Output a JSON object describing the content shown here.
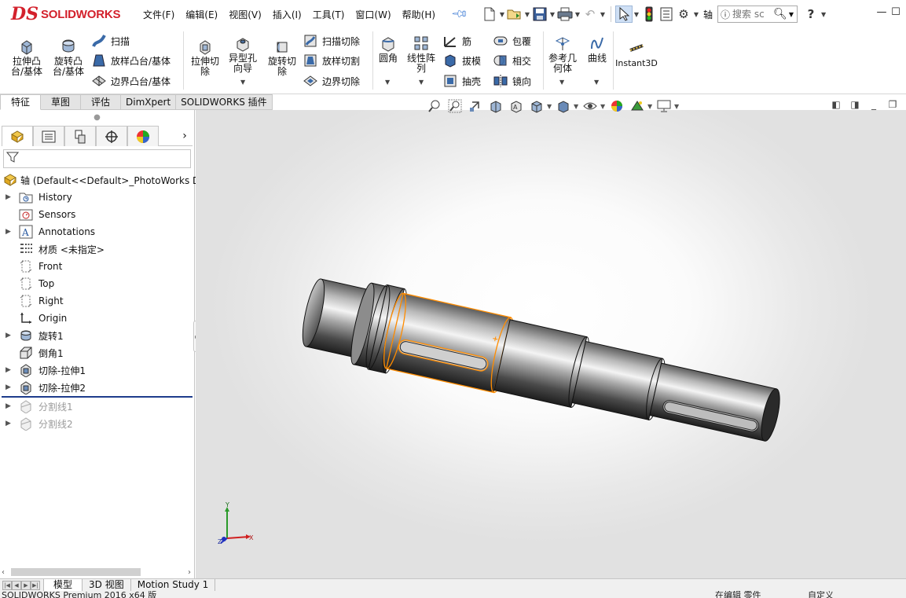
{
  "app": {
    "logo_ds": "DS",
    "logo_text": "SOLIDWORKS",
    "colors": {
      "brand": "#d3212c",
      "selection": "#ff8c00",
      "rollback_bar": "#1e3c8c"
    }
  },
  "menu": [
    "文件(F)",
    "编辑(E)",
    "视图(V)",
    "插入(I)",
    "工具(T)",
    "窗口(W)",
    "帮助(H)"
  ],
  "quick_access": {
    "icons": [
      "new-document-icon",
      "open-icon",
      "save-icon",
      "print-icon",
      "undo-icon",
      "select-pointer-icon",
      "rebuild-icon",
      "file-properties-icon",
      "options-gear-icon"
    ],
    "document_name": "轴",
    "search_placeholder": "搜索 sc",
    "help_label": "?"
  },
  "ribbon": {
    "extrude_boss": "拉伸凸\n台/基体",
    "revolve_boss": "旋转凸\n台/基体",
    "sweep": "扫描",
    "loft_boss": "放样凸台/基体",
    "boundary_boss": "边界凸台/基体",
    "extrude_cut": "拉伸切\n除",
    "hole_wizard": "异型孔\n向导",
    "revolve_cut": "旋转切\n除",
    "swept_cut": "扫描切除",
    "lofted_cut": "放样切割",
    "boundary_cut": "边界切除",
    "fillet": "圆角",
    "linear_pattern": "线性阵\n列",
    "rib": "筋",
    "draft": "拔模",
    "shell": "抽壳",
    "wrap": "包覆",
    "intersect": "相交",
    "mirror": "镜向",
    "ref_geometry": "参考几\n何体",
    "curves": "曲线",
    "instant3d": "Instant3D"
  },
  "cm_tabs": [
    "特征",
    "草图",
    "评估",
    "DimXpert",
    "SOLIDWORKS 插件"
  ],
  "feature_tree": {
    "root": "轴  (Default<<Default>_PhotoWorks D",
    "items": [
      {
        "label": "History",
        "icon": "history-folder-icon",
        "expand": true,
        "dim": false
      },
      {
        "label": "Sensors",
        "icon": "sensors-icon",
        "expand": false,
        "dim": false
      },
      {
        "label": "Annotations",
        "icon": "annotations-icon",
        "expand": true,
        "dim": false
      },
      {
        "label": "材质 <未指定>",
        "icon": "material-icon",
        "expand": false,
        "dim": false
      },
      {
        "label": "Front",
        "icon": "plane-icon",
        "expand": false,
        "dim": false
      },
      {
        "label": "Top",
        "icon": "plane-icon",
        "expand": false,
        "dim": false
      },
      {
        "label": "Right",
        "icon": "plane-icon",
        "expand": false,
        "dim": false
      },
      {
        "label": "Origin",
        "icon": "origin-icon",
        "expand": false,
        "dim": false
      },
      {
        "label": "旋转1",
        "icon": "revolve-feature-icon",
        "expand": true,
        "dim": false
      },
      {
        "label": "倒角1",
        "icon": "chamfer-feature-icon",
        "expand": false,
        "dim": false
      },
      {
        "label": "切除-拉伸1",
        "icon": "cut-extrude-icon",
        "expand": true,
        "dim": false
      },
      {
        "label": "切除-拉伸2",
        "icon": "cut-extrude-icon",
        "expand": true,
        "dim": false
      },
      {
        "label": "分割线1",
        "icon": "split-line-icon",
        "expand": true,
        "dim": true
      },
      {
        "label": "分割线2",
        "icon": "split-line-icon",
        "expand": true,
        "dim": true
      }
    ]
  },
  "triad": {
    "x": "X",
    "y": "Y",
    "z": "Z"
  },
  "bottom_tabs": [
    "模型",
    "3D 视图",
    "Motion Study 1"
  ],
  "status": {
    "left": "SOLIDWORKS Premium 2016 x64 版",
    "mid": "在编辑 零件",
    "right": "自定义"
  }
}
